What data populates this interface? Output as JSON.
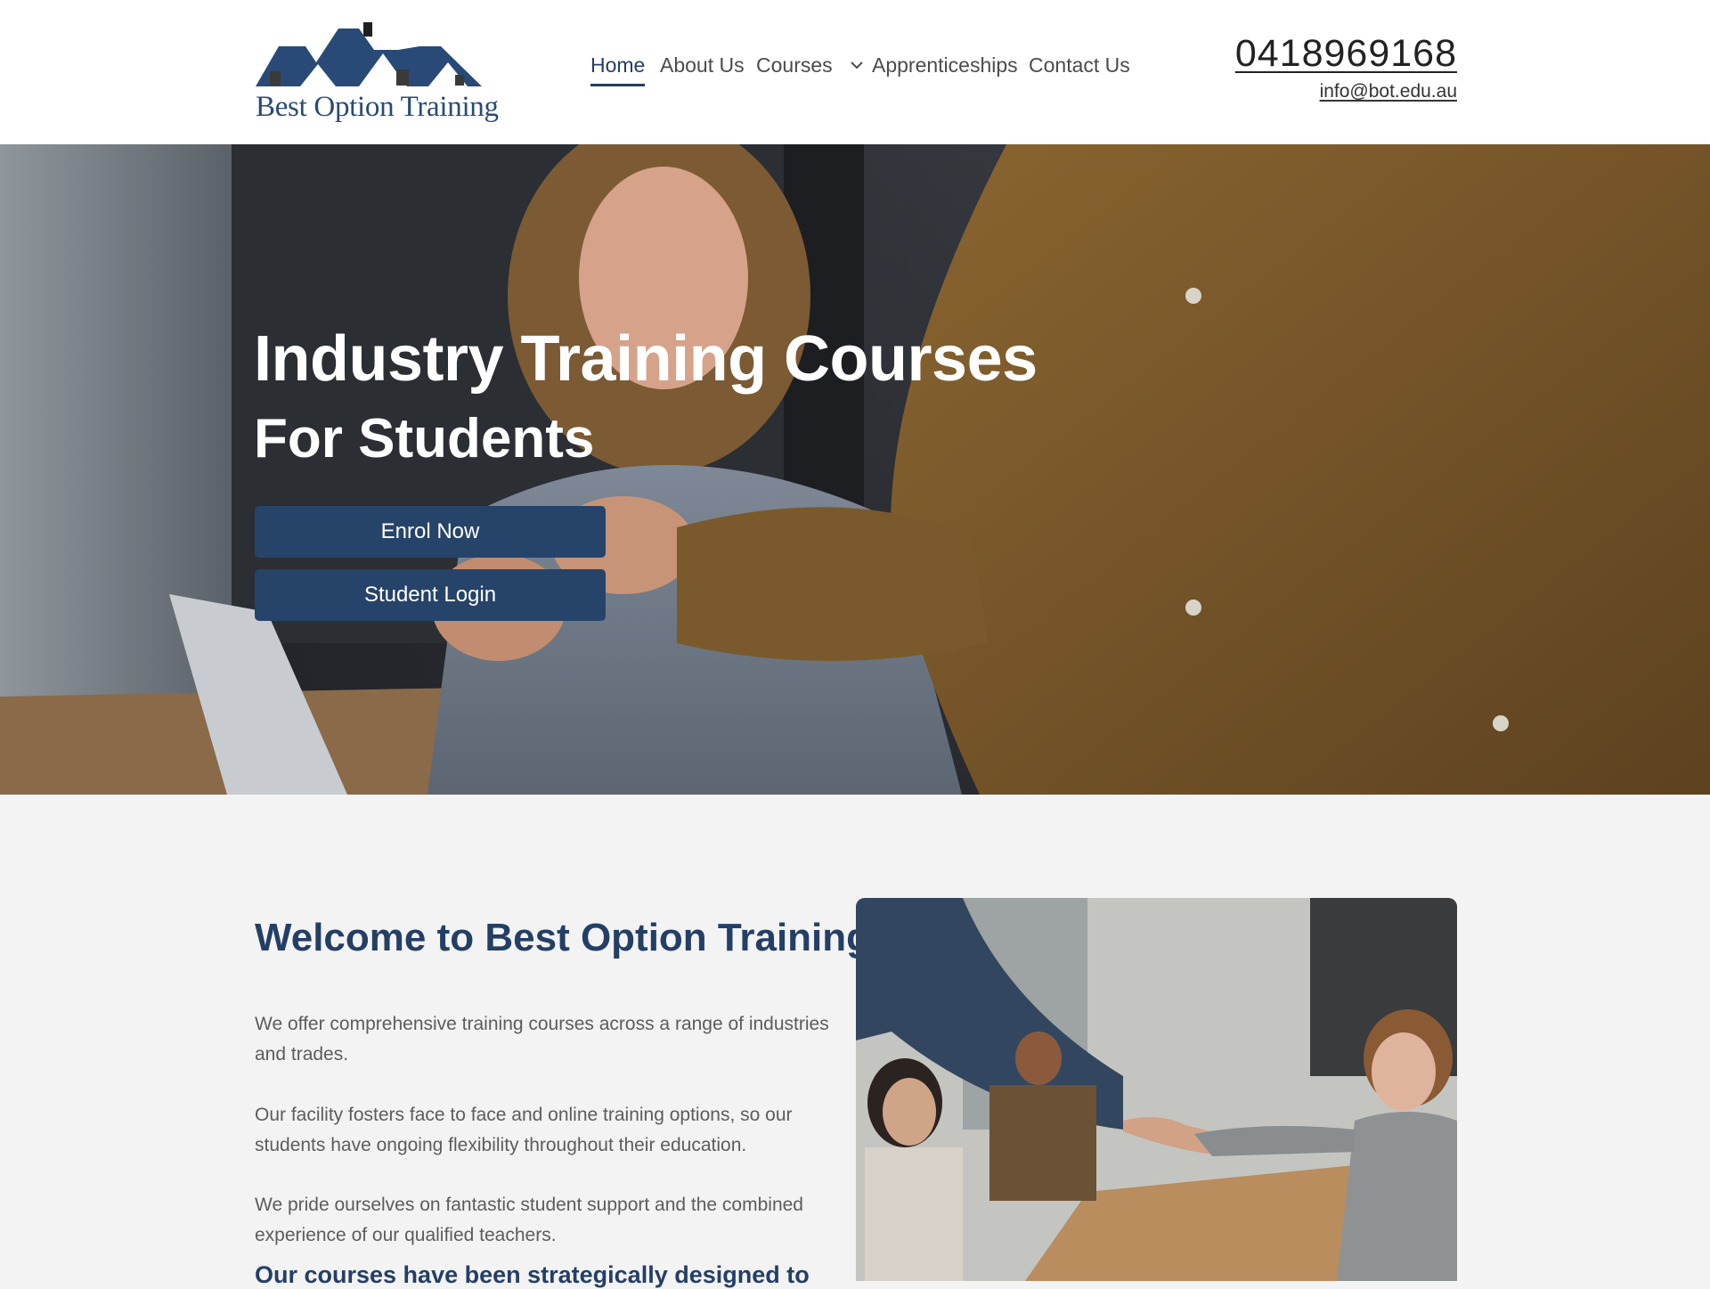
{
  "brand": {
    "name": "Best Option Training",
    "primary": "#264369",
    "heading": "#243f66"
  },
  "nav": {
    "items": [
      {
        "label": "Home",
        "active": true
      },
      {
        "label": "About Us"
      },
      {
        "label": "Courses",
        "has_dropdown": true
      },
      {
        "label": "Apprenticeships"
      },
      {
        "label": "Contact Us"
      }
    ]
  },
  "contact": {
    "phone": "0418969168",
    "email": "info@bot.edu.au"
  },
  "hero": {
    "title_line1": "Industry Training Courses",
    "title_line2": "For Students",
    "enrol_label": "Enrol Now",
    "login_label": "Student Login"
  },
  "welcome": {
    "title": "Welcome to Best Option Training,",
    "paragraphs": [
      "We offer comprehensive training courses across a range of industries and trades.",
      "Our facility fosters face to face and online training options, so our students have ongoing flexibility throughout their education.",
      "We pride ourselves on fantastic student support and the combined experience of our qualified teachers."
    ],
    "cut_heading": "Our courses have been strategically designed to"
  }
}
